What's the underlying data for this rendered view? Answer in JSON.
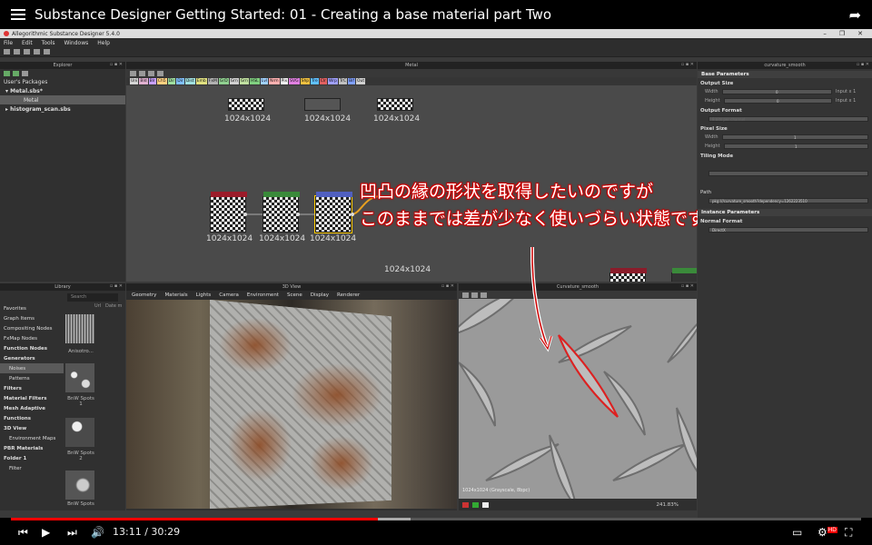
{
  "youtube": {
    "title": "Substance Designer Getting Started: 01 - Creating a base material part Two",
    "time_current": "13:11",
    "time_separator": "/",
    "time_total": "30:29",
    "progress_played": 0.432,
    "progress_loaded": 0.47,
    "hd_badge": "HD"
  },
  "app": {
    "title": "Allegorithmic Substance Designer 5.4.0",
    "menu": [
      "File",
      "Edit",
      "Tools",
      "Windows",
      "Help"
    ]
  },
  "explorer": {
    "title": "Explorer",
    "rows": [
      "User's Packages",
      "Metal.sbs*",
      "Metal",
      "histogram_scan.sbs"
    ]
  },
  "graph": {
    "title": "Metal",
    "palette": [
      "Uni",
      "Bld",
      "Blr",
      "Ch5",
      "Dir",
      "Dir",
      "Dist",
      "Emb",
      "FxM",
      "GrD",
      "Grn",
      "Grn",
      "HSL",
      "Lvl",
      "Nrm",
      "Pix",
      "SVG",
      "Shp",
      "Tre",
      "Clr",
      "Wrp",
      "TrC",
      "Bif",
      "Out"
    ],
    "node_labels": [
      "1024x1024",
      "1024x1024",
      "1024x1024",
      "1024x1024",
      "1024x1024",
      "1024x1024",
      "1024x1024",
      "1024x1024",
      "1024x1024"
    ],
    "annotation_line1": "凹凸の縁の形状を取得したいのですが",
    "annotation_line2": "このままでは差が少なく使いづらい状態です"
  },
  "properties": {
    "title": "curvature_smooth",
    "base_parameters": "Base Parameters",
    "output_size": "Output Size",
    "width_label": "Width",
    "width_value": "0",
    "width_unit": "Input x 1",
    "height_label": "Height",
    "height_value": "0",
    "height_unit": "Input x 1",
    "output_format": "Output Format",
    "output_format_value": "8 bits per channel",
    "pixel_size": "Pixel Size",
    "px_width_value": "1",
    "px_height_value": "1",
    "tiling_mode": "Tiling Mode",
    "path_label": "Path",
    "path_value": "pkg:///curvature_smooth?dependency=1262223510",
    "instance_parameters": "Instance Parameters",
    "normal_format": "Normal Format",
    "normal_format_value": "DirectX"
  },
  "library": {
    "title": "Library",
    "search_placeholder": "Search",
    "col_url": "Url",
    "col_date": "Date m",
    "categories": [
      "Favorites",
      "Graph Items",
      "Compositing Nodes",
      "FxMap Nodes",
      "Function Nodes",
      "Generators",
      "Noises",
      "Patterns",
      "Filters",
      "Material Filters",
      "Mesh Adaptive",
      "Functions",
      "3D View",
      "Environment Maps",
      "PBR Materials",
      "Folder 1",
      "Filter"
    ],
    "thumbs": [
      "Anisotro...",
      "BnW Spots 1",
      "BnW Spots 2",
      "BnW Spots"
    ]
  },
  "view3d": {
    "title": "3D View",
    "menu": [
      "Geometry",
      "Materials",
      "Lights",
      "Camera",
      "Environment",
      "Scene",
      "Display",
      "Renderer"
    ]
  },
  "curvature": {
    "title": "Curvature_smooth",
    "overlay": "1024x1024 (Grayscale, 8bpc)",
    "zoom": "241.83%"
  },
  "colors": {
    "accent_red": "#ff0000",
    "annotation_glow": "#cc0000",
    "selection": "#5d5d5d"
  }
}
